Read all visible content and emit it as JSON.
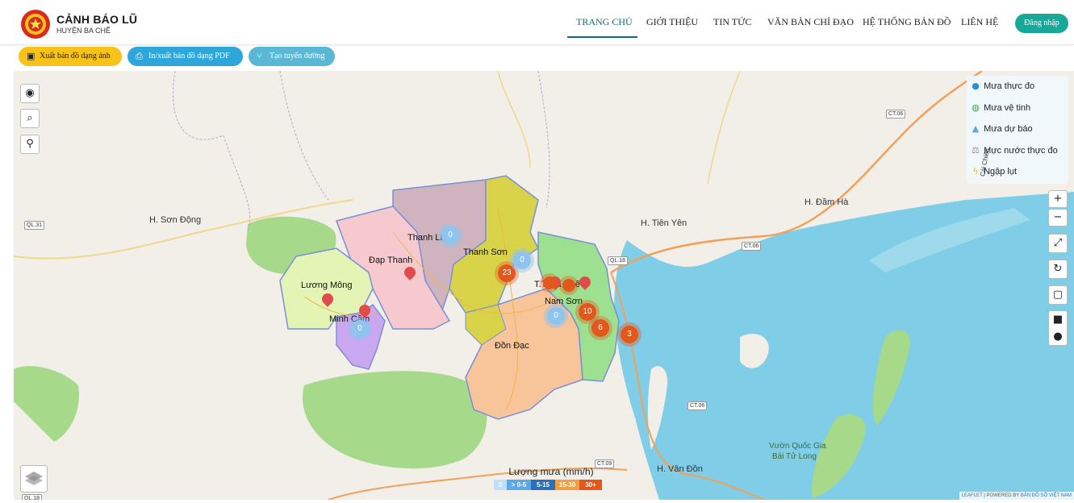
{
  "header": {
    "title": "CẢNH BÁO LŨ",
    "subtitle": "HUYỆN BA CHẼ",
    "nav": [
      "TRANG CHỦ",
      "GIỚI THIỆU",
      "TIN TỨC",
      "VĂN BẢN CHỈ ĐẠO",
      "HỆ THỐNG BẢN ĐỒ",
      "LIÊN HỆ"
    ],
    "active_nav": "TRANG CHỦ",
    "login": "Đăng nhập"
  },
  "toolbar": {
    "export_image": "Xuất bản đồ dạng ảnh",
    "export_pdf": "In/xuất bản đồ dạng PDF",
    "create_route": "Tạo tuyến đường"
  },
  "map": {
    "layers": [
      {
        "label": "Mưa thực đo",
        "icon": "water-drop-icon"
      },
      {
        "label": "Mưa vệ tinh",
        "icon": "globe-icon"
      },
      {
        "label": "Mưa dự báo",
        "icon": "area-chart-icon"
      },
      {
        "label": "Mực nước thực đo",
        "icon": "scale-icon"
      },
      {
        "label": "Ngập lụt",
        "icon": "lightning-icon"
      }
    ],
    "places": [
      "H. Sơn Động",
      "H. Tiên Yên",
      "H. Đầm Hà",
      "H. Vân Đồn",
      "Vườn Quốc Gia",
      "Bái Tử Long",
      "Cái Chiên"
    ],
    "communes": [
      "Thanh Lâm",
      "Đạp Thanh",
      "Thanh Sơn",
      "Lương Mông",
      "Minh Cầm",
      "T.T. Ba Chẽ",
      "Nam Sơn",
      "Đồn Đạc"
    ],
    "roads": [
      "QL.31",
      "CT.06",
      "QL.18",
      "CT.09"
    ],
    "clusters": [
      "23",
      "10",
      "6",
      "3",
      "0",
      "0",
      "0",
      "0"
    ],
    "rain_legend": {
      "title": "Lượng mưa (mm/h)",
      "bins": [
        "0",
        "> 0-5",
        "5-15",
        "15-30",
        "30+"
      ],
      "colors": [
        "#bfe0fb",
        "#5aa9e6",
        "#2a6fba",
        "#f0a042",
        "#e4571a"
      ]
    },
    "attribution": {
      "leaflet": "LEAFLET",
      "powered": "| POWERED BY",
      "provider": "BẢN ĐỒ SỐ VIỆT NAM"
    }
  },
  "colors": {
    "accent": "#0f6e72",
    "login": "#17a89a",
    "sea": "#7fcde6",
    "forest": "#a6d98a"
  }
}
